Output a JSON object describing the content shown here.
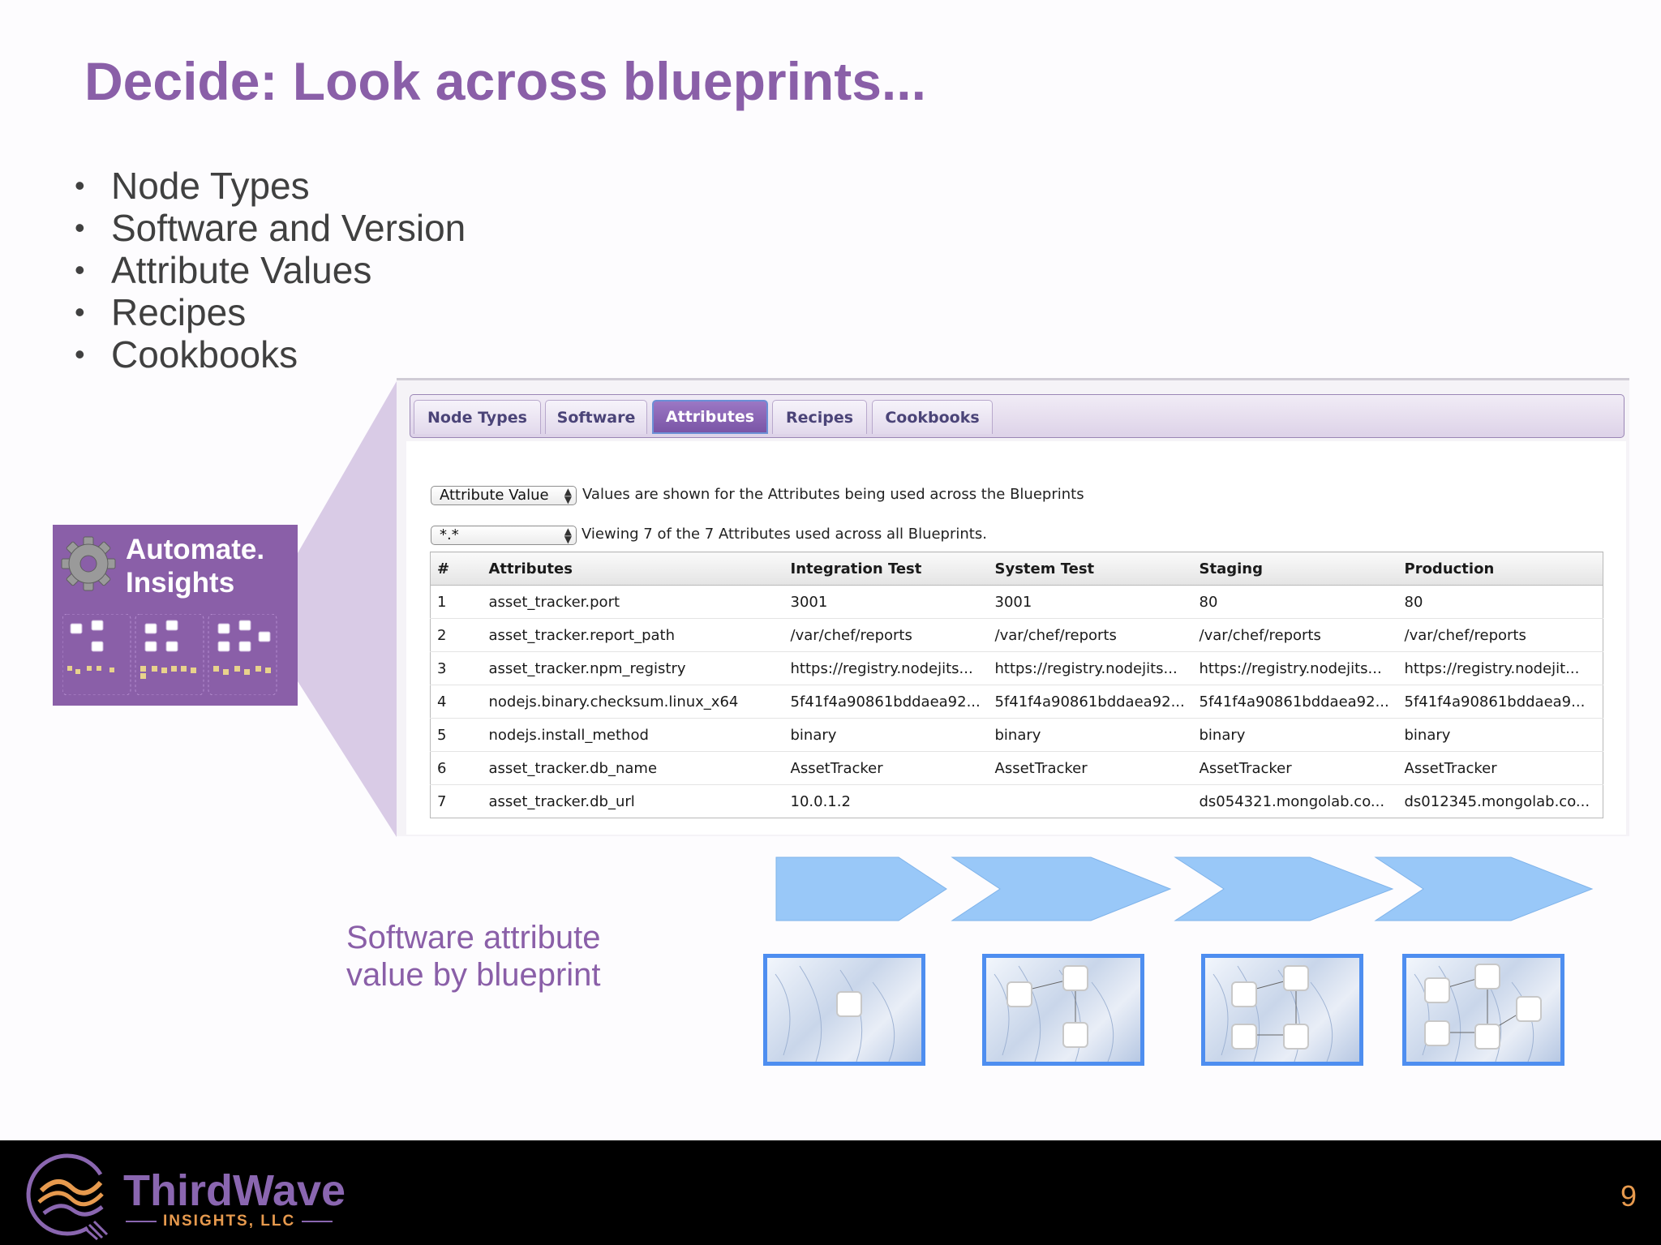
{
  "slide": {
    "title": "Decide: Look across blueprints...",
    "bullets": [
      "Node Types",
      "Software and Version",
      "Attribute Values",
      "Recipes",
      "Cookbooks"
    ],
    "caption_line1": "Software attribute",
    "caption_line2": "value by blueprint",
    "page_number": "9"
  },
  "badge": {
    "line1": "Automate.",
    "line2": "Insights"
  },
  "tabs": [
    {
      "label": "Node Types",
      "active": false
    },
    {
      "label": "Software",
      "active": false
    },
    {
      "label": "Attributes",
      "active": true
    },
    {
      "label": "Recipes",
      "active": false
    },
    {
      "label": "Cookbooks",
      "active": false
    }
  ],
  "filters": {
    "mode_select": "Attribute Value",
    "mode_note": "Values are shown for the Attributes being used across the Blueprints",
    "pattern_select": "*.*",
    "pattern_note": "Viewing 7 of the 7 Attributes used across all Blueprints."
  },
  "table": {
    "headers": [
      "#",
      "Attributes",
      "Integration Test",
      "System Test",
      "Staging",
      "Production"
    ],
    "rows": [
      [
        "1",
        "asset_tracker.port",
        "3001",
        "3001",
        "80",
        "80"
      ],
      [
        "2",
        "asset_tracker.report_path",
        "/var/chef/reports",
        "/var/chef/reports",
        "/var/chef/reports",
        "/var/chef/reports"
      ],
      [
        "3",
        "asset_tracker.npm_registry",
        "https://registry.nodejits...",
        "https://registry.nodejits...",
        "https://registry.nodejits...",
        "https://registry.nodejit..."
      ],
      [
        "4",
        "nodejs.binary.checksum.linux_x64",
        "5f41f4a90861bddaea92...",
        "5f41f4a90861bddaea92...",
        "5f41f4a90861bddaea92...",
        "5f41f4a90861bddaea9..."
      ],
      [
        "5",
        "nodejs.install_method",
        "binary",
        "binary",
        "binary",
        "binary"
      ],
      [
        "6",
        "asset_tracker.db_name",
        "AssetTracker",
        "AssetTracker",
        "AssetTracker",
        "AssetTracker"
      ],
      [
        "7",
        "asset_tracker.db_url",
        "10.0.1.2",
        "",
        "ds054321.mongolab.co...",
        "ds012345.mongolab.co..."
      ]
    ]
  },
  "brand": {
    "name_part1": "Third",
    "name_part2": "Wave",
    "subtitle": "INSIGHTS, LLC"
  },
  "colors": {
    "accent_purple": "#8a5fa8",
    "arrow_blue": "#99c8f8",
    "frame_blue": "#4e8ef0",
    "orange": "#e79a4e"
  }
}
